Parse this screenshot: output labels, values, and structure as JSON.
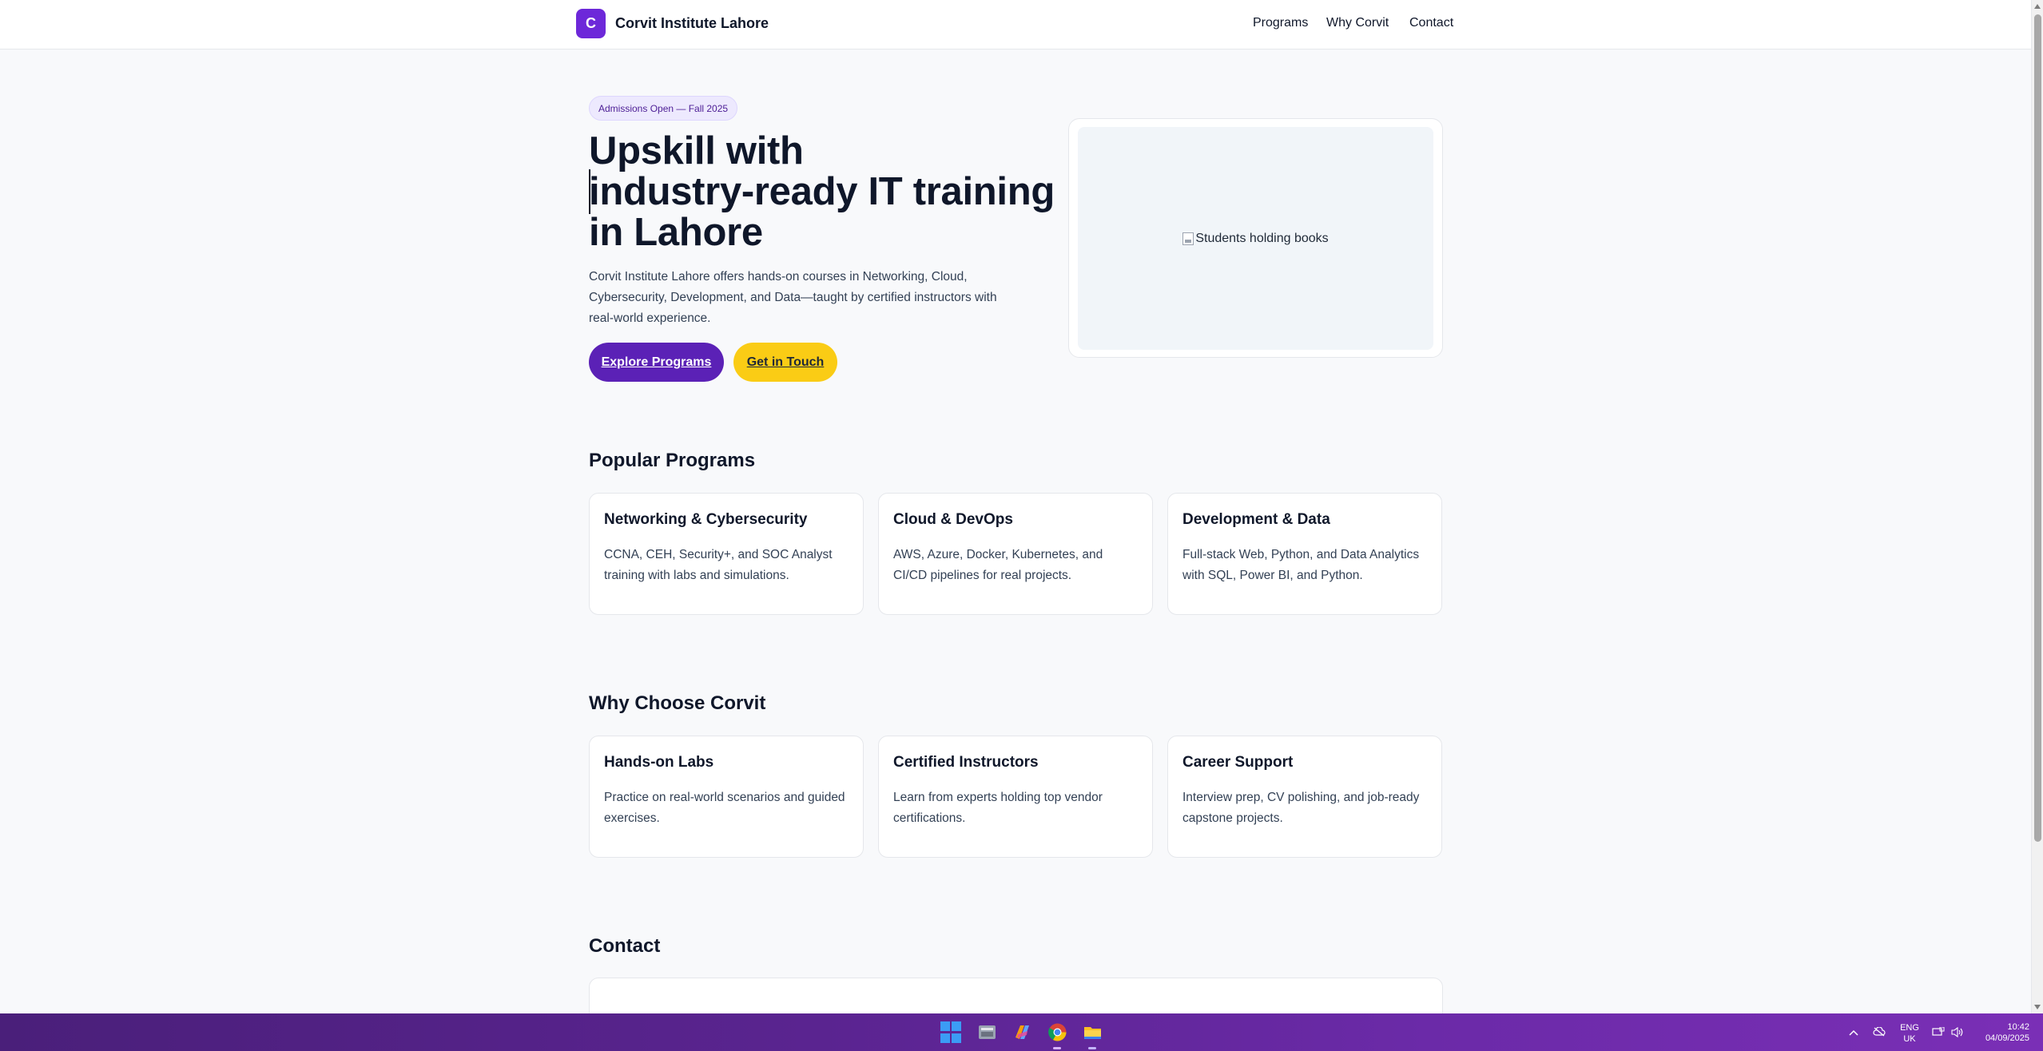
{
  "header": {
    "brand_letter": "C",
    "brand_name": "Corvit Institute Lahore",
    "nav": [
      "Programs",
      "Why Corvit",
      "Contact"
    ]
  },
  "hero": {
    "badge": "Admissions Open — Fall 2025",
    "title_lines": [
      "Upskill with",
      "industry-ready IT training",
      "in Lahore"
    ],
    "description": "Corvit Institute Lahore offers hands-on courses in Networking, Cloud, Cybersecurity, Development, and Data—taught by certified instructors with real-world experience.",
    "primary_cta": "Explore Programs",
    "secondary_cta": "Get in Touch",
    "image_alt": "Students holding books"
  },
  "programs": {
    "title": "Popular Programs",
    "cards": [
      {
        "title": "Networking & Cybersecurity",
        "text": "CCNA, CEH, Security+, and SOC Analyst training with labs and simulations."
      },
      {
        "title": "Cloud & DevOps",
        "text": "AWS, Azure, Docker, Kubernetes, and CI/CD pipelines for real projects."
      },
      {
        "title": "Development & Data",
        "text": "Full-stack Web, Python, and Data Analytics with SQL, Power BI, and Python."
      }
    ]
  },
  "why": {
    "title": "Why Choose Corvit",
    "cards": [
      {
        "title": "Hands-on Labs",
        "text": "Practice on real-world scenarios and guided exercises."
      },
      {
        "title": "Certified Instructors",
        "text": "Learn from experts holding top vendor certifications."
      },
      {
        "title": "Career Support",
        "text": "Interview prep, CV polishing, and job-ready capstone projects."
      }
    ]
  },
  "contact": {
    "title": "Contact"
  },
  "taskbar": {
    "icons": [
      "windows-start-icon",
      "file-manager-icon",
      "copilot-icon",
      "chrome-icon",
      "file-explorer-icon"
    ],
    "language": "ENG",
    "region": "UK",
    "time": "10:42",
    "date": "04/09/2025"
  },
  "colors": {
    "brand": "#6d28d9",
    "primary_button": "#5b21b6",
    "secondary_button": "#facc15",
    "background": "#f8f9fb"
  }
}
